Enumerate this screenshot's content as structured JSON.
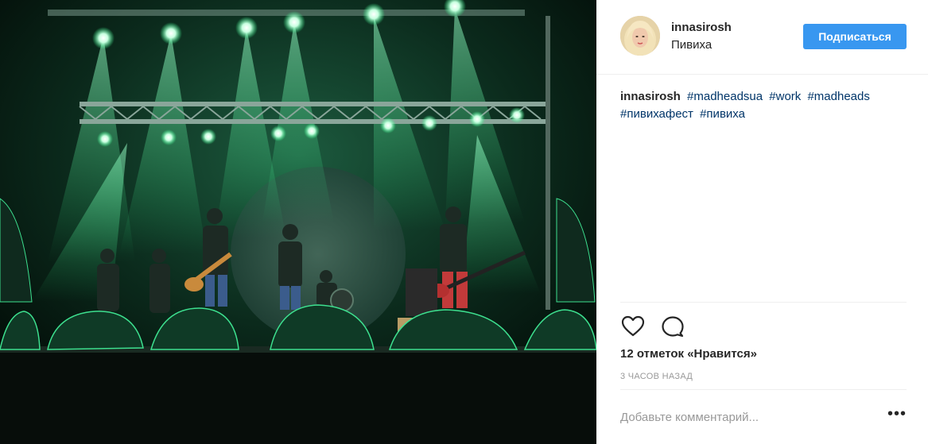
{
  "post": {
    "photo_alt": "",
    "author": {
      "username": "innasirosh",
      "location": "Пивиха"
    },
    "follow_label": "Подписаться",
    "caption": {
      "username": "innasirosh",
      "hashtags": [
        "#madheadsua",
        "#work",
        "#madheads",
        "#пивихафест",
        "#пивиха"
      ]
    },
    "likes_text": "12 отметок «Нравится»",
    "time_text": "3 часов назад",
    "comment_placeholder": "Добавьте комментарий...",
    "more_label": "•••",
    "icons": [
      "heart-icon",
      "comment-icon",
      "more-options-icon"
    ],
    "colors": {
      "accent": "#3897f0",
      "hashtag": "#003569",
      "meta": "#999999",
      "stage_light": "#2bff8a"
    }
  }
}
